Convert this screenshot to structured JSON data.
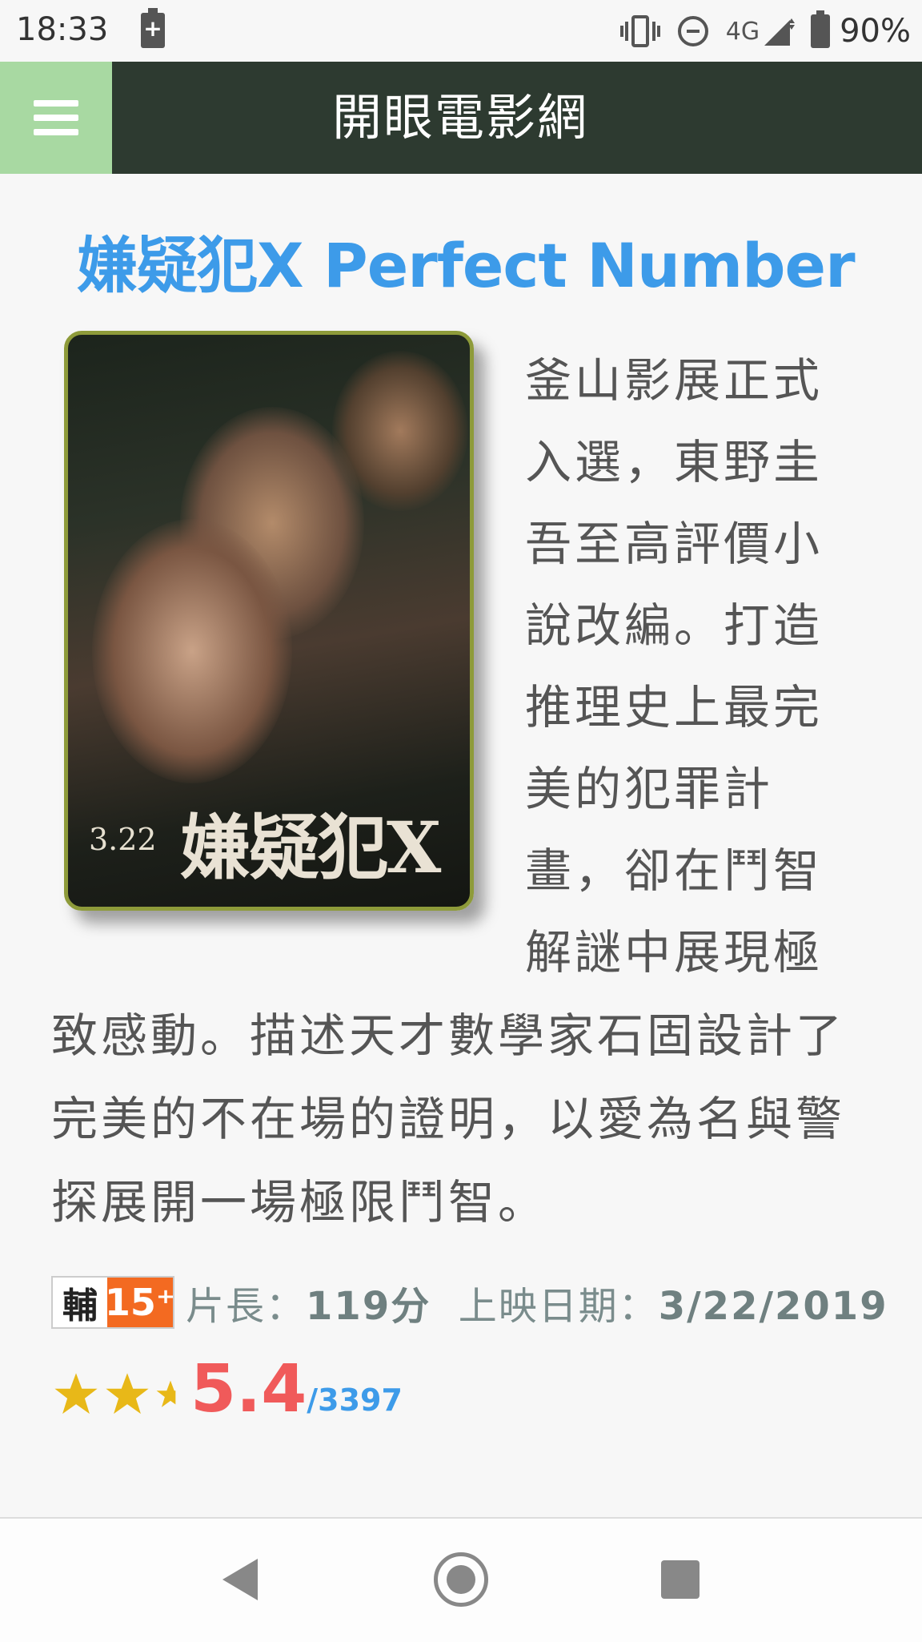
{
  "status_bar": {
    "time": "18:33",
    "network": "4G",
    "battery": "90%",
    "icons": [
      "battery-charging-icon",
      "vibrate-icon",
      "do-not-disturb-icon",
      "signal-icon",
      "battery-icon"
    ]
  },
  "header": {
    "menu_icon": "hamburger-menu-icon",
    "title": "開眼電影網",
    "colors": {
      "bar": "#2d3a30",
      "menu_bg": "#a8d9a2"
    }
  },
  "movie": {
    "title": "嫌疑犯X Perfect Number",
    "poster": {
      "title": "嫌疑犯X",
      "date": "3.22"
    },
    "synopsis_lines": [
      "釜山影展正式",
      "入選，東野圭",
      "吾至高評價小",
      "說改編。打造",
      "推理史上最完",
      "美的犯罪計",
      "畫，卻在鬥智",
      "解謎中展現極",
      "致感動。描述天才數學家石固設計了",
      "完美的不在場的證明，以愛為名與警",
      "探展開一場極限鬥智。"
    ],
    "rating_badge": {
      "label": "輔",
      "age": "15⁺"
    },
    "runtime_label": "片長：",
    "runtime_value": "119分",
    "release_label": "上映日期：",
    "release_value": "3/22/2019",
    "stars": 2.5,
    "score": "5.4",
    "votes": "/3397"
  },
  "nav": {
    "icons": [
      "back-icon",
      "home-icon",
      "recents-icon"
    ]
  }
}
